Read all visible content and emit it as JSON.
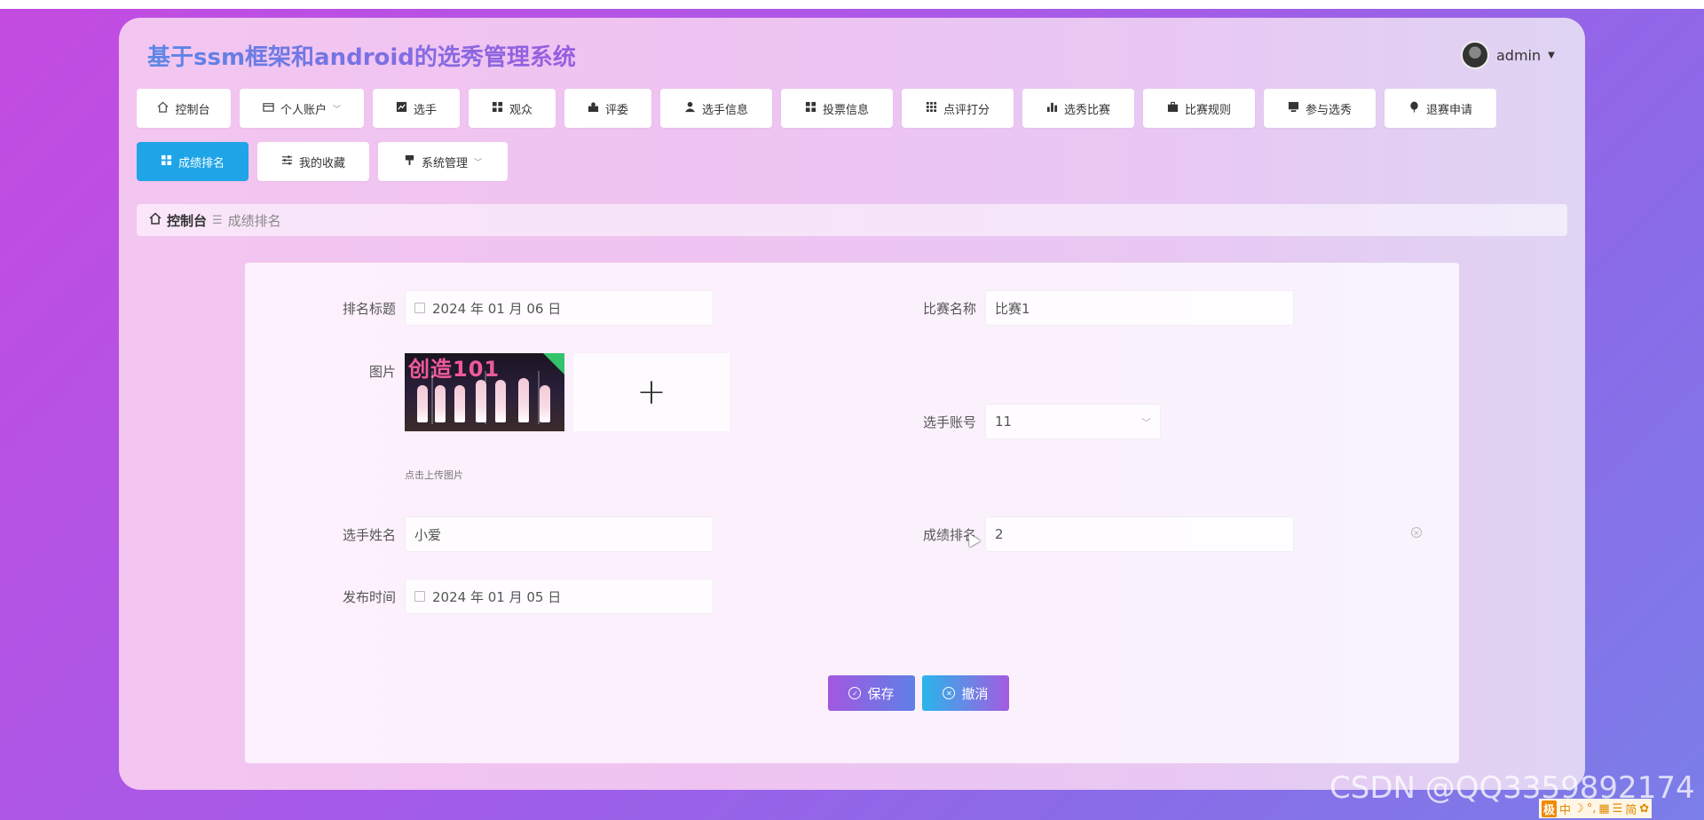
{
  "app": {
    "title": "基于ssm框架和android的选秀管理系统",
    "user": "admin"
  },
  "nav": {
    "items": [
      {
        "label": "控制台",
        "icon": "home-icon"
      },
      {
        "label": "个人账户",
        "icon": "wallet-icon",
        "dropdown": true
      },
      {
        "label": "选手",
        "icon": "chart-icon"
      },
      {
        "label": "观众",
        "icon": "grid-icon"
      },
      {
        "label": "评委",
        "icon": "person-card-icon"
      },
      {
        "label": "选手信息",
        "icon": "user-icon"
      },
      {
        "label": "投票信息",
        "icon": "grid-icon"
      },
      {
        "label": "点评打分",
        "icon": "apps-icon"
      },
      {
        "label": "选秀比赛",
        "icon": "bar-chart-icon"
      },
      {
        "label": "比赛规则",
        "icon": "briefcase-icon"
      },
      {
        "label": "参与选秀",
        "icon": "monitor-icon"
      },
      {
        "label": "退赛申请",
        "icon": "balloon-icon"
      },
      {
        "label": "成绩排名",
        "icon": "grid-icon",
        "active": true
      },
      {
        "label": "我的收藏",
        "icon": "sliders-icon"
      },
      {
        "label": "系统管理",
        "icon": "brush-icon",
        "dropdown": true
      }
    ]
  },
  "breadcrumb": {
    "home": "控制台",
    "current": "成绩排名"
  },
  "form": {
    "rank_title_label": "排名标题",
    "rank_title_value": "2024 年 01 月 06 日",
    "match_name_label": "比赛名称",
    "match_name_value": "比赛1",
    "image_label": "图片",
    "image_thumb_text": "创造101",
    "upload_hint": "点击上传图片",
    "player_account_label": "选手账号",
    "player_account_value": "11",
    "player_name_label": "选手姓名",
    "player_name_value": "小爱",
    "score_rank_label": "成绩排名",
    "score_rank_value": "2",
    "publish_time_label": "发布时间",
    "publish_time_value": "2024 年 01 月 05 日"
  },
  "buttons": {
    "save": "保存",
    "cancel": "撤消"
  },
  "watermark": "CSDN @QQ3359892174",
  "ime": {
    "items": [
      "极",
      "中",
      "☽",
      "°,",
      "▦",
      "☰",
      "简",
      "✿"
    ]
  },
  "colors": {
    "active_nav": "#1ea4e7",
    "save_gradient_start": "#a258e0",
    "cancel_gradient_start": "#29b5ea"
  }
}
